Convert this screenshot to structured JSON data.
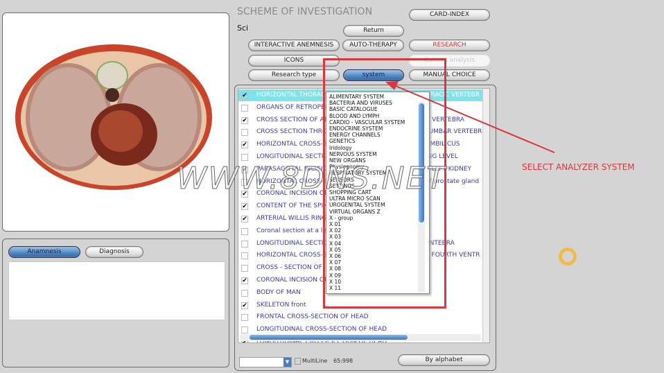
{
  "header": {
    "title": "SCHEME OF INVESTIGATION",
    "subtitle": "Sci"
  },
  "buttons": {
    "card_index": "CARD-INDEX",
    "return": "Return",
    "interactive_anemnesis": "INTERACTIVE ANEMNESIS",
    "auto_therapy": "AUTO-THERAPY",
    "research": "RESEARCH",
    "icons": "ICONS",
    "current_analysis": "Current analysis",
    "research_type": "Research type",
    "system": "system",
    "manual_choice": "MANUAL CHOICE",
    "by_alphabet": "By alphabet"
  },
  "left": {
    "tabs": [
      "Anamnesis",
      "Diagnosis"
    ],
    "active_tab": "Anamnesis"
  },
  "list": {
    "rows": [
      {
        "checked": true,
        "left": "HORIZONTAL THORAC",
        "right": "ORACIC VERTEBR",
        "selected": true
      },
      {
        "checked": false,
        "left": "ORGANS OF RETROPER",
        "right": ""
      },
      {
        "checked": true,
        "left": "CROSS SECTION OF AB",
        "right": "R VERTEBRA"
      },
      {
        "checked": false,
        "left": "CROSS SECTION THRO",
        "right": "LUMBAR VERTEBR"
      },
      {
        "checked": true,
        "left": "HORIZONTAL CROSS-S",
        "right": "UMBILICUS"
      },
      {
        "checked": false,
        "left": "LONGITUDINAL SECTIO",
        "right": "ING LEVEL"
      },
      {
        "checked": true,
        "left": "PARASAGITTAL INCISIO",
        "right": "E LEFT KIDNEY"
      },
      {
        "checked": false,
        "left": "HORIZONTAL CROSS-S",
        "right": "of prostate gland"
      },
      {
        "checked": true,
        "left": "CORONAL INCISION OF",
        "right": ""
      },
      {
        "checked": true,
        "left": "CONTENT OF THE SPIN",
        "right": ""
      },
      {
        "checked": true,
        "left": "ARTERIAL WILLIS RING",
        "right": ""
      },
      {
        "checked": false,
        "left": "Coronal section at a lev",
        "right": ""
      },
      {
        "checked": false,
        "left": "LONGITUDINAL SECTIO",
        "right": "ENTEBRA"
      },
      {
        "checked": false,
        "left": "HORIZONTAL CROSS-S",
        "right": "E FOURTH VENTR"
      },
      {
        "checked": false,
        "left": "CROSS - SECTION  OF",
        "right": ""
      },
      {
        "checked": true,
        "left": "CORONAL INCISION OF",
        "right": ""
      },
      {
        "checked": false,
        "left": "BODY OF MAN",
        "right": ""
      },
      {
        "checked": true,
        "left": "SKELETON front",
        "right": ""
      },
      {
        "checked": false,
        "left": "FRONTAL CROSS-SECTION OF HEAD",
        "right": ""
      },
      {
        "checked": false,
        "left": "LONGITUDINAL CROSS-SECTION OF HEAD",
        "right": ""
      },
      {
        "checked": true,
        "left": "LONGITUDINAL CROSS-SECTION OF HEAD",
        "right": ""
      }
    ]
  },
  "dropdown": {
    "items": [
      "ALIMENTARY SYSTEM",
      "BACTERIA AND VIRUSES",
      "BASIC CATALOGUE",
      "BLOOD AND LYMPH",
      "CARDIO - VASCULAR SYSTEM",
      "ENDOCRINE SYSTEM",
      "ENERGY CHANNELS",
      "GENETICS",
      "Iridology",
      "NERVOUS SYSTEM",
      "NEW ORGANS",
      "Physiognomy",
      "RESPIRATORY SYSTEM",
      "SENSORS",
      "SETTINGS",
      "SHOPPING CART",
      "ULTRA MICRO SCAN",
      "UROGENITAL SYSTEM",
      "VIRTUAL ORGANS Z",
      "X - group",
      "X 01",
      "X 02",
      "X 03",
      "X 04",
      "X 05",
      "X 06",
      "X 07",
      "X 08",
      "X 09",
      "X 10",
      "X 11"
    ]
  },
  "footer": {
    "multiline_label": "MultiLine",
    "counter": "65:998"
  },
  "annotation": {
    "text": "SELECT ANALYZER SYSTEM",
    "color": "#d9363e"
  },
  "watermark": "WWW.8DNS.NET"
}
